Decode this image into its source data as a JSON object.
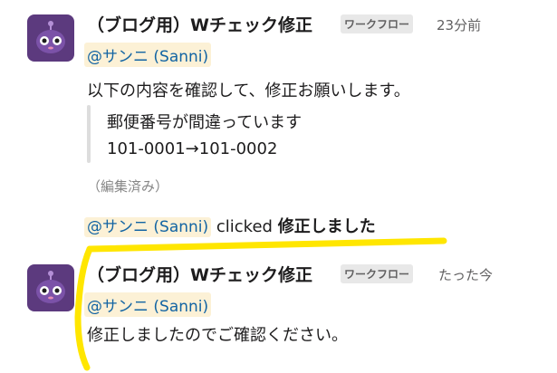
{
  "messages": [
    {
      "sender": "（ブログ用）Wチェック修正",
      "tag": "ワークフロー",
      "time": "23分前",
      "mention": "@サンニ (Sanni)",
      "text": "以下の内容を確認して、修正お願いします。",
      "quote": [
        "郵便番号が間違っています",
        "101-0001→101-0002"
      ],
      "edited": "（編集済み）"
    },
    {
      "sender": "（ブログ用）Wチェック修正",
      "tag": "ワークフロー",
      "time": "たった今",
      "mention": "@サンニ (Sanni)",
      "text": "修正しましたのでご確認ください。"
    }
  ],
  "action": {
    "mention": "@サンニ (Sanni)",
    "verb": "clicked",
    "button_label": "修正しました"
  },
  "colors": {
    "avatar_bg": "#5c3a7e",
    "mention_text": "#1264a3",
    "mention_bg": "#fcf1d6",
    "annotation": "#ffe600"
  },
  "icons": {
    "avatar": "robot-icon"
  }
}
